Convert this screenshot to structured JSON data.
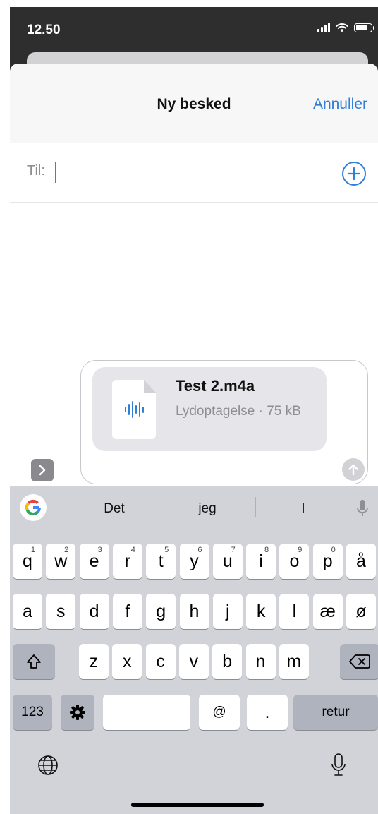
{
  "status_bar": {
    "time": "12.50",
    "battery_level": 0.75
  },
  "nav": {
    "title": "Ny besked",
    "cancel_label": "Annuller"
  },
  "to_field": {
    "label": "Til:",
    "value": ""
  },
  "attachment": {
    "file_name": "Test 2.m4a",
    "meta": "Lydoptagelse · 75 kB"
  },
  "suggestions": [
    "Det",
    "jeg",
    "I"
  ],
  "keyboard": {
    "row1": [
      {
        "k": "q",
        "h": "1"
      },
      {
        "k": "w",
        "h": "2"
      },
      {
        "k": "e",
        "h": "3"
      },
      {
        "k": "r",
        "h": "4"
      },
      {
        "k": "t",
        "h": "5"
      },
      {
        "k": "y",
        "h": "6"
      },
      {
        "k": "u",
        "h": "7"
      },
      {
        "k": "i",
        "h": "8"
      },
      {
        "k": "o",
        "h": "9"
      },
      {
        "k": "p",
        "h": "0"
      },
      {
        "k": "å",
        "h": ""
      }
    ],
    "row2": [
      "a",
      "s",
      "d",
      "f",
      "g",
      "h",
      "j",
      "k",
      "l",
      "æ",
      "ø"
    ],
    "row3": [
      "z",
      "x",
      "c",
      "v",
      "b",
      "n",
      "m"
    ],
    "numbers_label": "123",
    "at_label": "@",
    "period_label": ".",
    "return_label": "retur"
  },
  "icons": {
    "add": "plus-circle-icon",
    "send": "arrow-up-icon",
    "expand": "chevron-right-icon",
    "google": "google-g-icon",
    "mic": "microphone-icon",
    "globe": "globe-icon",
    "shift": "shift-icon",
    "backspace": "backspace-icon",
    "settings": "gear-icon",
    "file": "audio-file-icon"
  },
  "colors": {
    "accent": "#2f7fd9",
    "keyboard_bg": "#d1d3d9",
    "dark_key": "#aeb3be"
  }
}
